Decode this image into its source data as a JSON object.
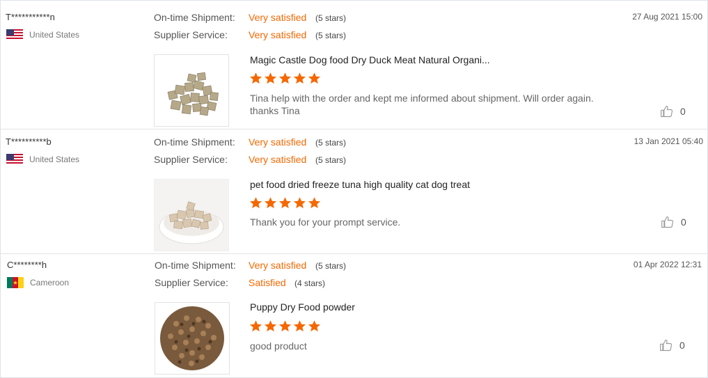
{
  "colors": {
    "accent": "#f56800",
    "star": "#f56800",
    "border": "#dde3ea"
  },
  "reviews": [
    {
      "user": "T***********n",
      "country": "United States",
      "flag": "us-flag-icon",
      "shipment_label": "On-time Shipment:",
      "shipment_value": "Very satisfied",
      "shipment_stars_text": "(5 stars)",
      "service_label": "Supplier Service:",
      "service_value": "Very satisfied",
      "service_stars_text": "(5 stars)",
      "date": "27 Aug 2021 15:00",
      "product_title": "Magic Castle Dog food Dry Duck Meat Natural Organi...",
      "rating": 5,
      "comment": "Tina help with the order and kept me informed about shipment.  Will order again. thanks Tina",
      "likes": "0",
      "image": "freeze-dried-duck-cubes-image"
    },
    {
      "user": "T**********b",
      "country": "United States",
      "flag": "us-flag-icon",
      "shipment_label": "On-time Shipment:",
      "shipment_value": "Very satisfied",
      "shipment_stars_text": "(5 stars)",
      "service_label": "Supplier Service:",
      "service_value": "Very satisfied",
      "service_stars_text": "(5 stars)",
      "date": "13 Jan 2021 05:40",
      "product_title": "pet food dried freeze tuna high quality cat dog treat",
      "rating": 5,
      "comment": "Thank you for your prompt service.",
      "likes": "0",
      "image": "freeze-dried-tuna-bowl-image"
    },
    {
      "user": "C********h",
      "country": "Cameroon",
      "flag": "cameroon-flag-icon",
      "shipment_label": "On-time Shipment:",
      "shipment_value": "Very satisfied",
      "shipment_stars_text": "(5 stars)",
      "service_label": "Supplier Service:",
      "service_value": "Satisfied",
      "service_stars_text": "(4 stars)",
      "date": "01 Apr 2022 12:31",
      "product_title": "Puppy Dry Food powder",
      "rating": 5,
      "comment": "good product",
      "likes": "0",
      "image": "dry-kibble-pile-image"
    }
  ]
}
